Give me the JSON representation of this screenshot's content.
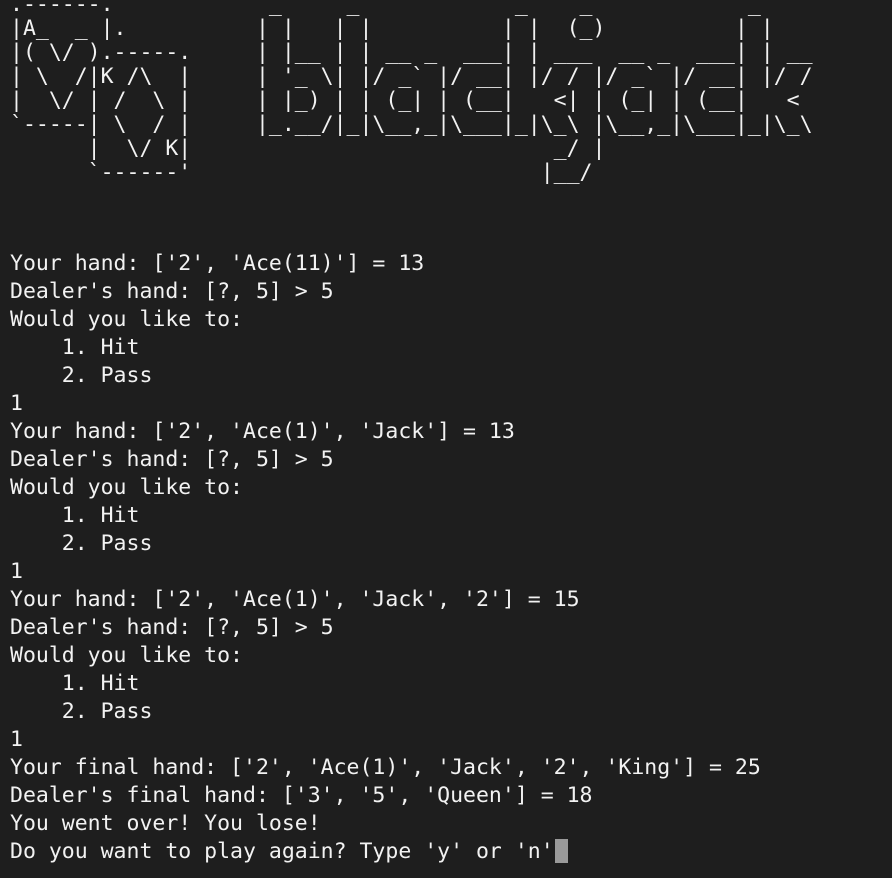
{
  "terminal": {
    "banner": ".------.            _     _            _    _            _\n|A_  _ |.          | |   | |          | |  (_)          | |\n|( \\/ ).-----.     | |__ | | __ _  ___| | ___  __ _  ___| | __\n| \\  /|K /\\  |     | '_ \\| |/ _` |/ __| |/ / |/ _` |/ __| |/ /\n|  \\/ | /  \\ |     | |_) | | (_| | (__|   <| | (_| | (__|   <\n`-----| \\  / |     |_.__/|_|\\__,_|\\___|_|\\_\\ |\\__,_|\\___|_|\\_\\\n      |  \\/ K|                            _/ |\n      `------'                           |__/",
    "lines": [
      "Your hand: ['2', 'Ace(11)'] = 13",
      "Dealer's hand: [?, 5] > 5",
      "Would you like to:",
      "    1. Hit",
      "    2. Pass",
      "1",
      "Your hand: ['2', 'Ace(1)', 'Jack'] = 13",
      "Dealer's hand: [?, 5] > 5",
      "Would you like to:",
      "    1. Hit",
      "    2. Pass",
      "1",
      "Your hand: ['2', 'Ace(1)', 'Jack', '2'] = 15",
      "Dealer's hand: [?, 5] > 5",
      "Would you like to:",
      "    1. Hit",
      "    2. Pass",
      "1",
      "Your final hand: ['2', 'Ace(1)', 'Jack', '2', 'King'] = 25",
      "Dealer's final hand: ['3', '5', 'Queen'] = 18",
      "You went over! You lose!"
    ],
    "prompt": "Do you want to play again? Type 'y' or 'n'"
  },
  "colors": {
    "background": "#1e1e1e",
    "text": "#f2f2f2",
    "cursor": "#9a9a9a"
  }
}
